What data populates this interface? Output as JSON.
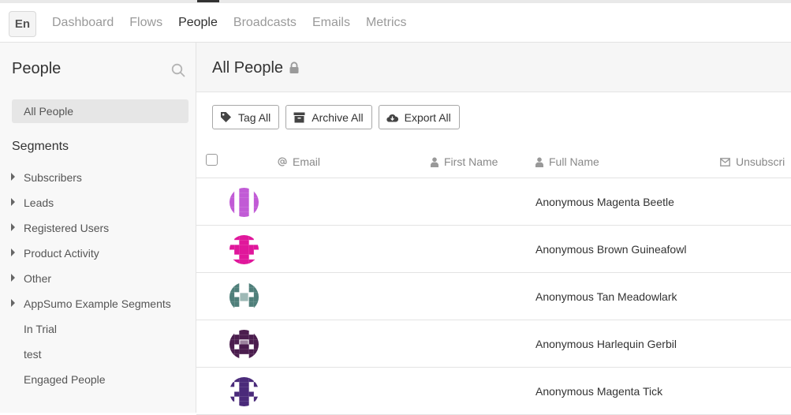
{
  "topbar": {
    "lang": "En",
    "nav": [
      "Dashboard",
      "Flows",
      "People",
      "Broadcasts",
      "Emails",
      "Metrics"
    ],
    "active": "People"
  },
  "sidebar": {
    "title": "People",
    "all_people": "All People",
    "segments_title": "Segments",
    "segments": [
      {
        "label": "Subscribers",
        "expandable": true
      },
      {
        "label": "Leads",
        "expandable": true
      },
      {
        "label": "Registered Users",
        "expandable": true
      },
      {
        "label": "Product Activity",
        "expandable": true
      },
      {
        "label": "Other",
        "expandable": true
      },
      {
        "label": "AppSumo Example Segments",
        "expandable": true
      },
      {
        "label": "In Trial",
        "expandable": false
      },
      {
        "label": "test",
        "expandable": false
      },
      {
        "label": "Engaged People",
        "expandable": false
      }
    ]
  },
  "main": {
    "title": "All People",
    "toolbar": {
      "tag_all": "Tag All",
      "archive_all": "Archive All",
      "export_all": "Export All"
    },
    "columns": {
      "email": "Email",
      "first_name": "First Name",
      "full_name": "Full Name",
      "unsubscribed": "Unsubscri"
    },
    "rows": [
      {
        "full_name": "Anonymous Magenta Beetle",
        "avatar_color": "#c15bd6"
      },
      {
        "full_name": "Anonymous Brown Guineafowl",
        "avatar_color": "#e0179b"
      },
      {
        "full_name": "Anonymous Tan Meadowlark",
        "avatar_color": "#4f7f7a"
      },
      {
        "full_name": "Anonymous Harlequin Gerbil",
        "avatar_color": "#4b1d4e"
      },
      {
        "full_name": "Anonymous Magenta Tick",
        "avatar_color": "#4a2a7a"
      }
    ]
  }
}
